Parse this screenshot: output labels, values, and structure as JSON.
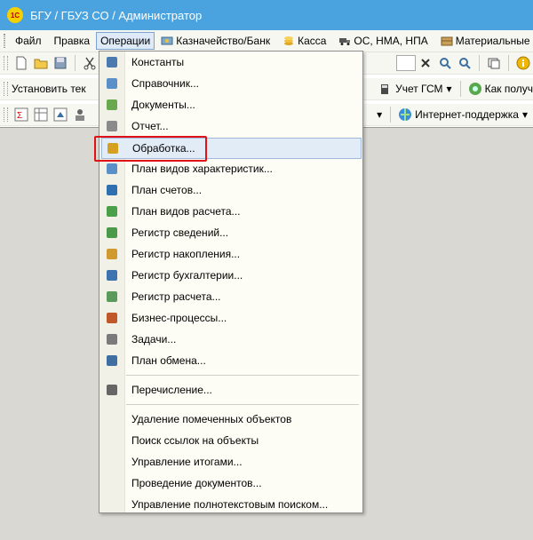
{
  "window": {
    "title": "БГУ / ГБУЗ СО / Администратор",
    "logo_text": "1С"
  },
  "menubar": {
    "items": [
      {
        "label": "Файл"
      },
      {
        "label": "Правка"
      },
      {
        "label": "Операции"
      },
      {
        "label": "Казначейство/Банк"
      },
      {
        "label": "Касса"
      },
      {
        "label": "ОС, НМА, НПА"
      },
      {
        "label": "Материальные запа"
      }
    ]
  },
  "toolbar2": {
    "set_label": "Установить тек",
    "fuel_label": "Учет ГСМ",
    "receive_label": "Как получ"
  },
  "toolbar3": {
    "support_label": "Интернет-поддержка"
  },
  "dropdown": {
    "groups": [
      [
        "Константы",
        "Справочник...",
        "Документы...",
        "Отчет...",
        "Обработка...",
        "План видов характеристик...",
        "План счетов...",
        "План видов расчета...",
        "Регистр сведений...",
        "Регистр накопления...",
        "Регистр бухгалтерии...",
        "Регистр расчета...",
        "Бизнес-процессы...",
        "Задачи...",
        "План обмена..."
      ],
      [
        "Перечисление..."
      ],
      [
        "Удаление помеченных объектов",
        "Поиск ссылок на объекты",
        "Управление итогами...",
        "Проведение документов...",
        "Управление полнотекстовым поиском..."
      ]
    ],
    "highlighted": "Обработка..."
  },
  "colors": {
    "titlebar": "#4aa3de",
    "highlight_border": "#e01218",
    "menu_bg": "#fdfdf6"
  }
}
